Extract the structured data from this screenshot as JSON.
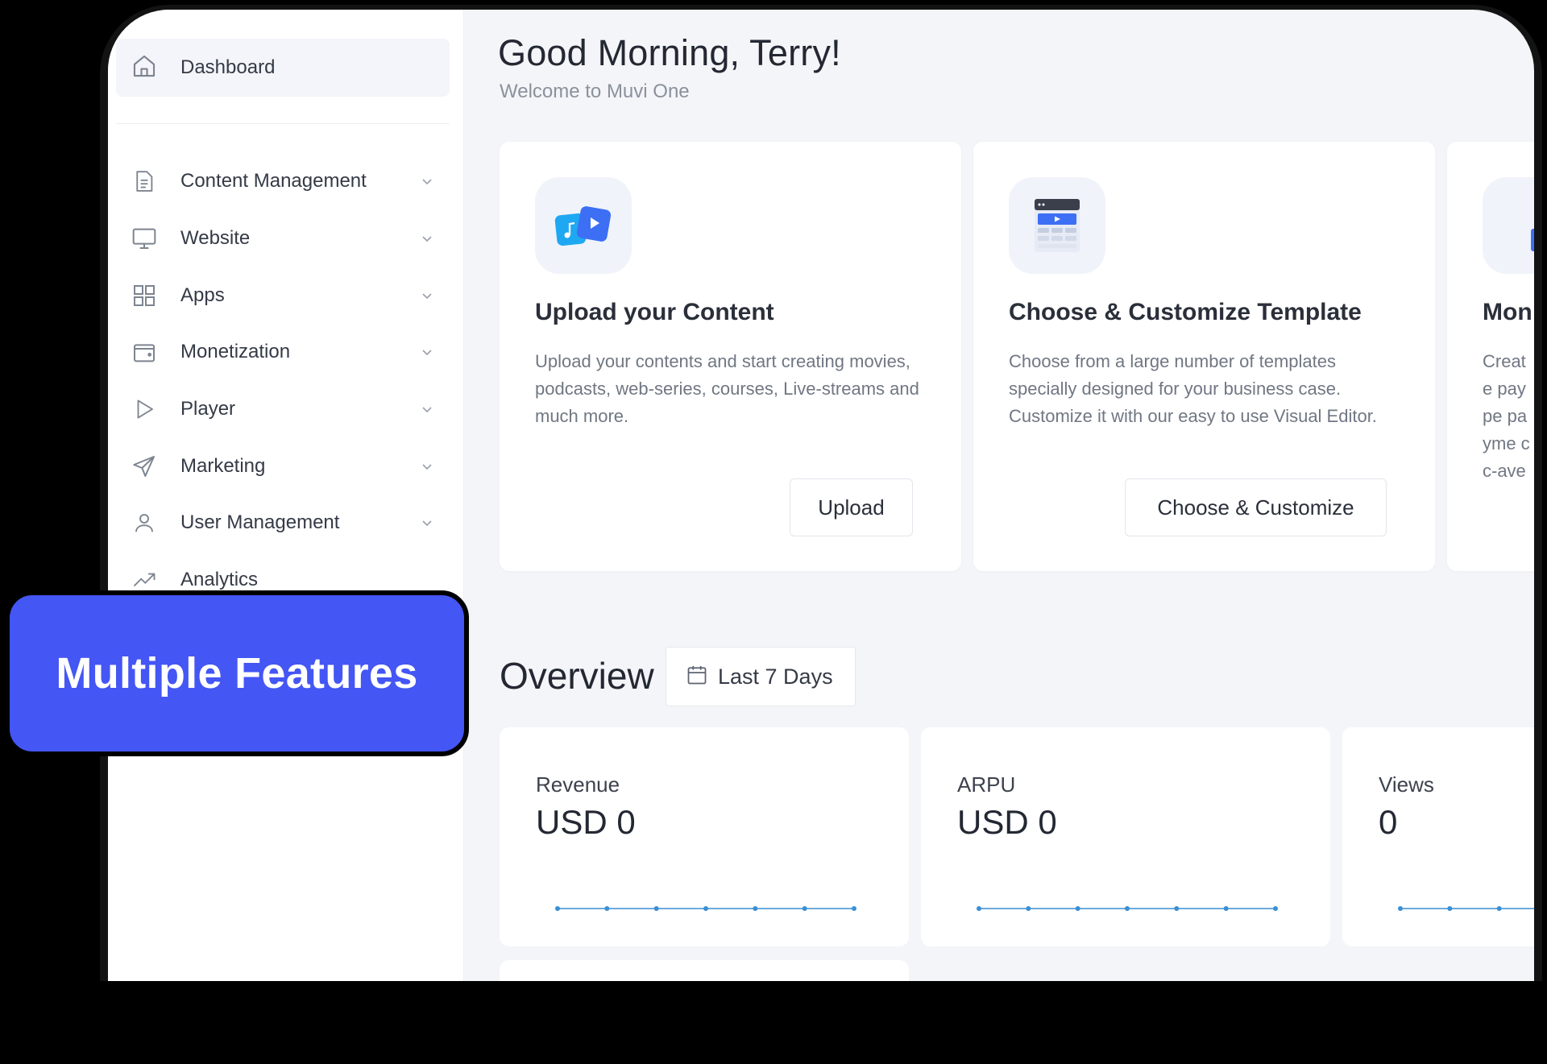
{
  "sidebar": {
    "dashboard": {
      "label": "Dashboard",
      "icon": "home-icon"
    },
    "items": [
      {
        "label": "Content Management",
        "icon": "document-icon",
        "expandable": true
      },
      {
        "label": "Website",
        "icon": "monitor-icon",
        "expandable": true
      },
      {
        "label": "Apps",
        "icon": "grid-icon",
        "expandable": true
      },
      {
        "label": "Monetization",
        "icon": "wallet-icon",
        "expandable": true
      },
      {
        "label": "Player",
        "icon": "play-icon",
        "expandable": true
      },
      {
        "label": "Marketing",
        "icon": "send-icon",
        "expandable": true
      },
      {
        "label": "User Management",
        "icon": "user-icon",
        "expandable": true
      },
      {
        "label": "Analytics",
        "icon": "trend-icon",
        "expandable": false
      }
    ]
  },
  "badge": {
    "label": "Multiple Features",
    "color": "#4456f4"
  },
  "header": {
    "greeting": "Good Morning, Terry!",
    "subtitle": "Welcome to Muvi One"
  },
  "cards": [
    {
      "title": "Upload your Content",
      "description": "Upload your contents and start creating movies, podcasts, web-series, courses, Live-streams and much more.",
      "button": "Upload",
      "icon": "media-files-icon"
    },
    {
      "title": "Choose & Customize Template",
      "description": "Choose from a large number of templates specially designed for your business case. Customize it with our easy to use Visual Editor.",
      "button": "Choose & Customize",
      "icon": "template-icon"
    },
    {
      "title": "Mon",
      "description": "Create pay pe payme cc-ave",
      "icon": "money-plant-icon"
    }
  ],
  "overview": {
    "title": "Overview",
    "range": "Last 7 Days",
    "stats": [
      {
        "label": "Revenue",
        "value": "USD 0"
      },
      {
        "label": "ARPU",
        "value": "USD 0"
      },
      {
        "label": "Views",
        "value": "0"
      }
    ]
  },
  "colors": {
    "accent": "#4456f4",
    "sparkline": "#3b8fd4"
  }
}
